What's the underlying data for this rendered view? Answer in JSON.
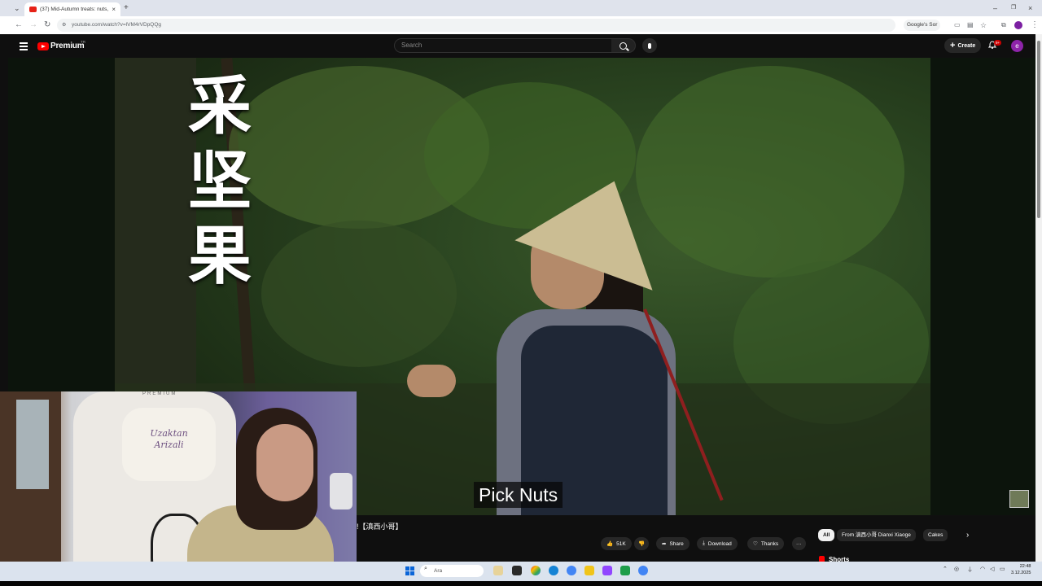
{
  "browser": {
    "tab_title": "(37) Mid-Autumn treats: nuts, ...",
    "url": "youtube.com/watch?v=lVM4rVDpQQg",
    "google_search_label": "Google's Sor"
  },
  "youtube": {
    "brand": "Premium",
    "brand_sup": "TR",
    "search_placeholder": "Search",
    "create_label": "Create",
    "notif_badge": "9+",
    "avatar_letter": "e"
  },
  "video": {
    "overlay_title": "采坚果",
    "caption": "Pick Nuts",
    "title": "!【滇西小哥】",
    "likes": "51K",
    "share_label": "Share",
    "download_label": "Download",
    "thanks_label": "Thanks",
    "more_label": "···"
  },
  "chips": [
    "All",
    "From 滇西小哥 Dianxi Xiaoge",
    "Cakes"
  ],
  "shorts_label": "Shorts",
  "webcam": {
    "chair_premium": "PREMIUM",
    "chair_text_line1": "Uzaktan",
    "chair_text_line2": "Arizali"
  },
  "taskbar": {
    "search_placeholder": "Ara",
    "time": "22:48",
    "date": "3.12.2025"
  },
  "colors": {
    "yt_red": "#ff0000",
    "yt_bg": "#0f0f0f",
    "taskbar": "#dbe3ee"
  }
}
